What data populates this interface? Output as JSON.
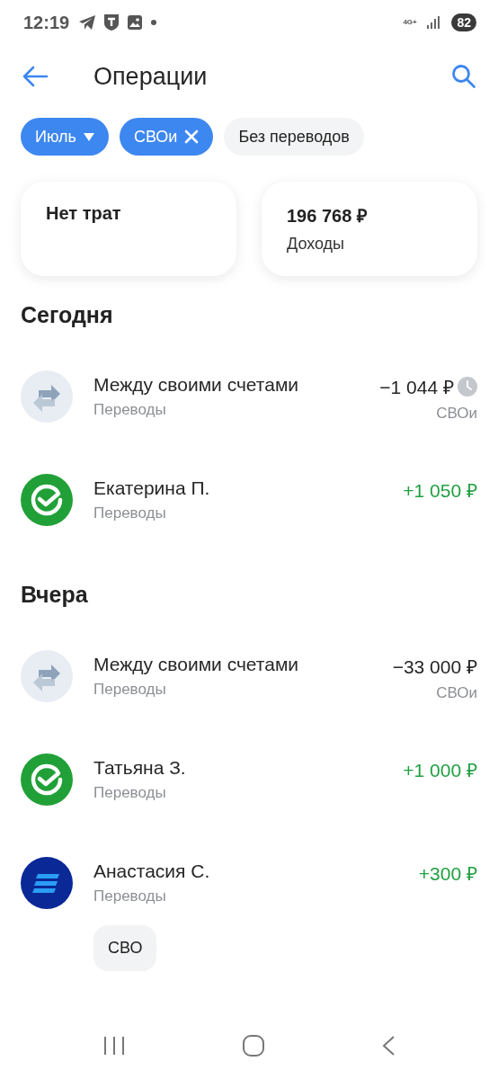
{
  "status_bar": {
    "time": "12:19",
    "network": "4G+",
    "battery": "82"
  },
  "header": {
    "title": "Операции"
  },
  "filters": [
    {
      "label": "Июль",
      "kind": "dropdown",
      "selected": true
    },
    {
      "label": "СВОи",
      "kind": "removable",
      "selected": true
    },
    {
      "label": "Без переводов",
      "kind": "plain",
      "selected": false
    }
  ],
  "summary": [
    {
      "title": "Нет трат"
    },
    {
      "title": "196 768 ₽",
      "label": "Доходы"
    }
  ],
  "sections": [
    {
      "title": "Сегодня",
      "operations": [
        {
          "kind": "transfer",
          "name": "Между своими счетами",
          "category": "Переводы",
          "amount": "−1 044 ₽",
          "income": false,
          "pending": true,
          "account": "СВОи"
        },
        {
          "kind": "check",
          "name": "Екатерина П.",
          "category": "Переводы",
          "amount": "+1 050 ₽",
          "income": true,
          "pending": false
        }
      ]
    },
    {
      "title": "Вчера",
      "operations": [
        {
          "kind": "transfer",
          "name": "Между своими счетами",
          "category": "Переводы",
          "amount": "−33 000 ₽",
          "income": false,
          "pending": false,
          "account": "СВОи"
        },
        {
          "kind": "check",
          "name": "Татьяна З.",
          "category": "Переводы",
          "amount": "+1 000 ₽",
          "income": true,
          "pending": false
        },
        {
          "kind": "stripes",
          "name": "Анастасия С.",
          "category": "Переводы",
          "amount": "+300 ₽",
          "income": true,
          "pending": false,
          "tag": "СВО"
        }
      ]
    }
  ]
}
